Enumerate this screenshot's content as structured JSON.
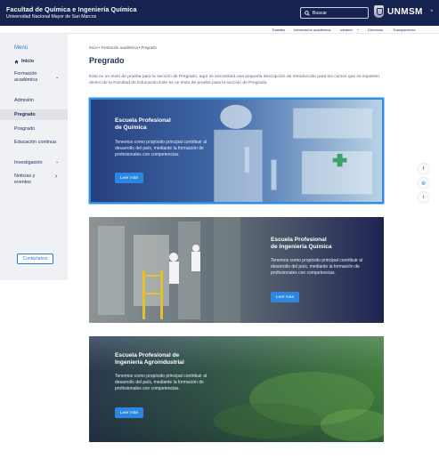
{
  "header": {
    "faculty": "Facultad de Química e Ingeniería  Química",
    "university": "Universidad Nacional Mayor de San Marcos",
    "search_label": "Buscar",
    "logo_text": "UNMSM",
    "close_glyph": "×",
    "bg_color": "#16224f"
  },
  "utilnav": {
    "items": [
      "Trámites",
      "Información académica",
      "Intranet",
      "Directorio",
      "Transparencia"
    ],
    "intranet_chevron": "⌄"
  },
  "sidebar": {
    "menu_label": "Menú",
    "home": "Inicio",
    "formacion": "Formación académica",
    "admision": "Admisión",
    "pregrado": "Pregrado",
    "posgrado": "Posgrado",
    "educacion": "Educación continua",
    "investigacion": "Investigación",
    "noticias": "Noticias y eventos",
    "contact": "Contáctanos",
    "chev_down": "⌄",
    "chev_right": "›"
  },
  "main": {
    "breadcrumb": "Inicio  •  Formación académica  •  Pregrado",
    "title": "Pregrado",
    "intro": "Este es un texto de prueba para la sección de Pregrado, aquí se encontrará una pequeña descripción de introducción para los cursos que se imparten dentro de la Facultad de Educación.Este es un texto de prueba para la sección de Pregrado.",
    "cards": [
      {
        "title1": "Escuela Profesional",
        "title2": "de Química",
        "desc": "Tenemos como propósito principal contribuir al desarrollo del país, mediante la formación de profesionales con competencias.",
        "button": "Leer más"
      },
      {
        "title1": "Escuela Profesional",
        "title2": "de Ingeniería Química",
        "desc": "Tenemos como propósito principal contribuir al desarrollo del país, mediante la formación de profesionales con competencias.",
        "button": "Leer más"
      },
      {
        "title1": "Escuela Profesional de",
        "title2": "Ingeniería Agroindustrial",
        "desc": "Tenemos como propósito principal contribuir al desarrollo del país, mediante la formación de profesionales con competencias.",
        "button": "Leer más"
      }
    ]
  },
  "social": {
    "facebook": "f",
    "instagram": "◎",
    "twitter": "t"
  },
  "colors": {
    "accent": "#2b86e0",
    "navy": "#16224f",
    "active_card_border": "#2f8de4"
  }
}
